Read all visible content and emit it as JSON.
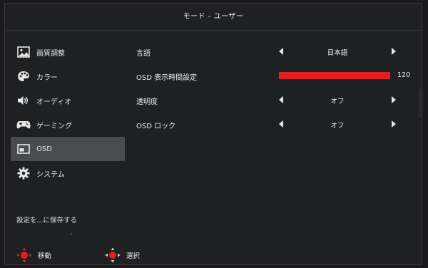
{
  "title": "モード - ユーザー",
  "sidebar": {
    "items": [
      {
        "label": "画質調整",
        "icon": "picture-icon"
      },
      {
        "label": "カラー",
        "icon": "palette-icon"
      },
      {
        "label": "オーディオ",
        "icon": "speaker-icon"
      },
      {
        "label": "ゲーミング",
        "icon": "gamepad-icon"
      },
      {
        "label": "OSD",
        "icon": "osd-window-icon",
        "active": true
      },
      {
        "label": "システム",
        "icon": "gear-icon"
      }
    ],
    "save_text": "設定を...に保存する"
  },
  "settings": [
    {
      "label": "言語",
      "value": "日本語"
    },
    {
      "label": "OSD 表示時間設定",
      "value": "120",
      "level": 1.0
    },
    {
      "label": "透明度",
      "value": "オフ"
    },
    {
      "label": "OSD ロック",
      "value": "オフ"
    }
  ],
  "footer": {
    "move_label": "移動",
    "select_label": "選択"
  },
  "colors": {
    "accent": "#e41e1e",
    "active_bg": "#4a4b4e",
    "panel_bg": "#1f2022"
  }
}
